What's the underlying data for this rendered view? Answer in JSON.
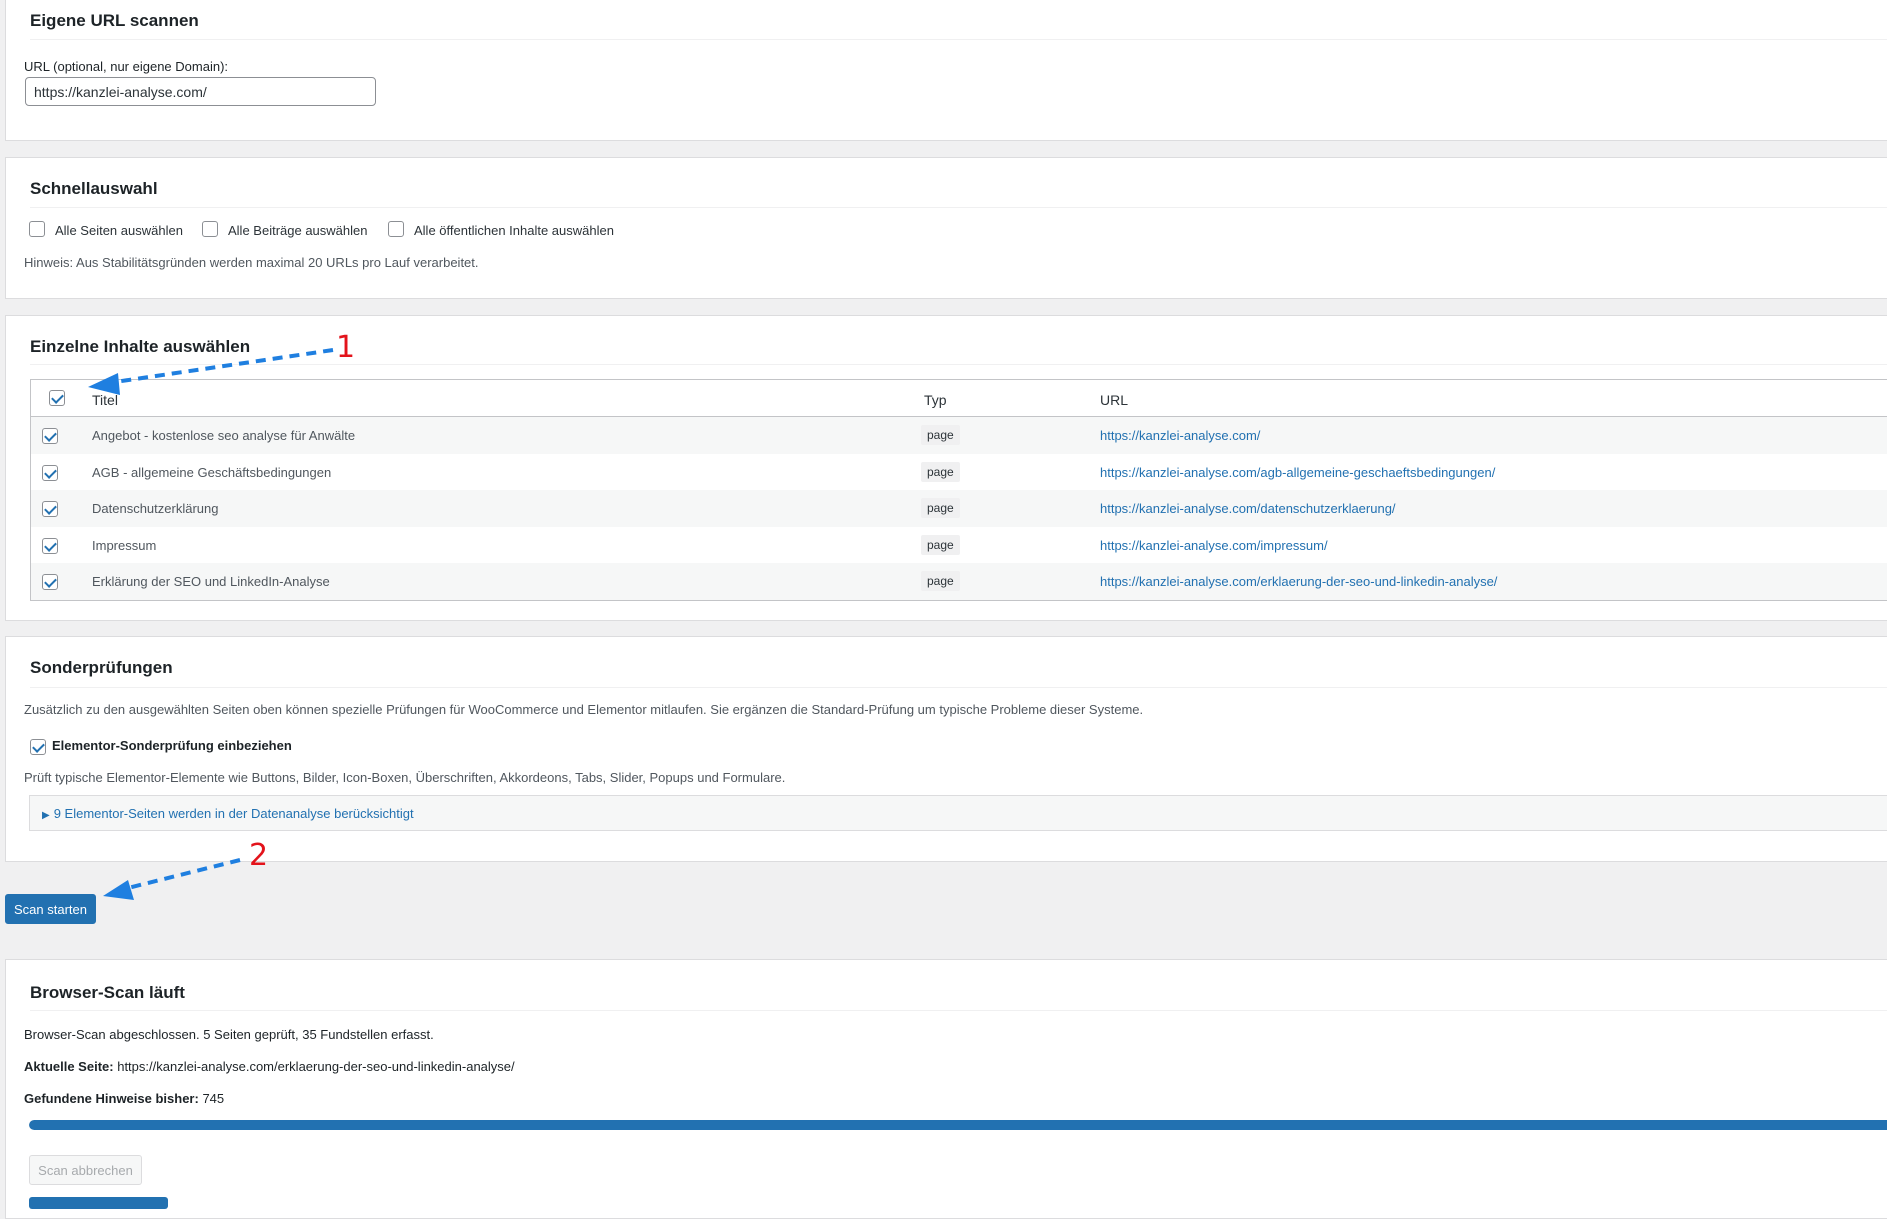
{
  "url_card": {
    "title": "Eigene URL scannen",
    "label": "URL (optional, nur eigene Domain):",
    "value": "https://kanzlei-analyse.com/"
  },
  "quick_card": {
    "title": "Schnellauswahl",
    "options": [
      {
        "label": "Alle Seiten auswählen",
        "checked": false
      },
      {
        "label": "Alle Beiträge auswählen",
        "checked": false
      },
      {
        "label": "Alle öffentlichen Inhalte auswählen",
        "checked": false
      }
    ],
    "hint": "Hinweis: Aus Stabilitätsgründen werden maximal 20 URLs pro Lauf verarbeitet."
  },
  "items_card": {
    "title": "Einzelne Inhalte auswählen",
    "columns": {
      "title": "Titel",
      "type": "Typ",
      "url": "URL"
    },
    "select_all_checked": true,
    "rows": [
      {
        "checked": true,
        "title": "Angebot - kostenlose seo analyse für Anwälte",
        "type": "page",
        "url": "https://kanzlei-analyse.com/"
      },
      {
        "checked": true,
        "title": "AGB - allgemeine Geschäftsbedingungen",
        "type": "page",
        "url": "https://kanzlei-analyse.com/agb-allgemeine-geschaeftsbedingungen/"
      },
      {
        "checked": true,
        "title": "Datenschutzerklärung",
        "type": "page",
        "url": "https://kanzlei-analyse.com/datenschutzerklaerung/"
      },
      {
        "checked": true,
        "title": "Impressum",
        "type": "page",
        "url": "https://kanzlei-analyse.com/impressum/"
      },
      {
        "checked": true,
        "title": "Erklärung der SEO und LinkedIn-Analyse",
        "type": "page",
        "url": "https://kanzlei-analyse.com/erklaerung-der-seo-und-linkedin-analyse/"
      }
    ]
  },
  "special_card": {
    "title": "Sonderprüfungen",
    "description": "Zusätzlich zu den ausgewählten Seiten oben können spezielle Prüfungen für WooCommerce und Elementor mitlaufen. Sie ergänzen die Standard-Prüfung um typische Probleme dieser Systeme.",
    "elementor_checked": true,
    "elementor_label": "Elementor-Sonderprüfung einbeziehen",
    "elementor_description": "Prüft typische Elementor-Elemente wie Buttons, Bilder, Icon-Boxen, Überschriften, Akkordeons, Tabs, Slider, Popups und Formulare.",
    "details_marker": "▶",
    "details_summary": "9 Elementor-Seiten werden in der Datenanalyse berücksichtigt"
  },
  "actions": {
    "scan_label": "Scan starten"
  },
  "browser_card": {
    "title": "Browser-Scan läuft",
    "status": "Browser-Scan abgeschlossen. 5 Seiten geprüft, 35 Fundstellen erfasst.",
    "current_page_label": "Aktuelle Seite:",
    "current_page_value": "https://kanzlei-analyse.com/erklaerung-der-seo-und-linkedin-analyse/",
    "found_label": "Gefundene Hinweise bisher:",
    "found_value": "745",
    "progress_percent": 100,
    "cancel_label": "Scan abbrechen"
  },
  "annotations": {
    "marker_1": "1",
    "marker_2": "2",
    "arrow_color": "#1f7fe0",
    "marker_color": "#e3131b"
  },
  "colors": {
    "accent": "#2271b1",
    "background": "#f0f0f1"
  }
}
